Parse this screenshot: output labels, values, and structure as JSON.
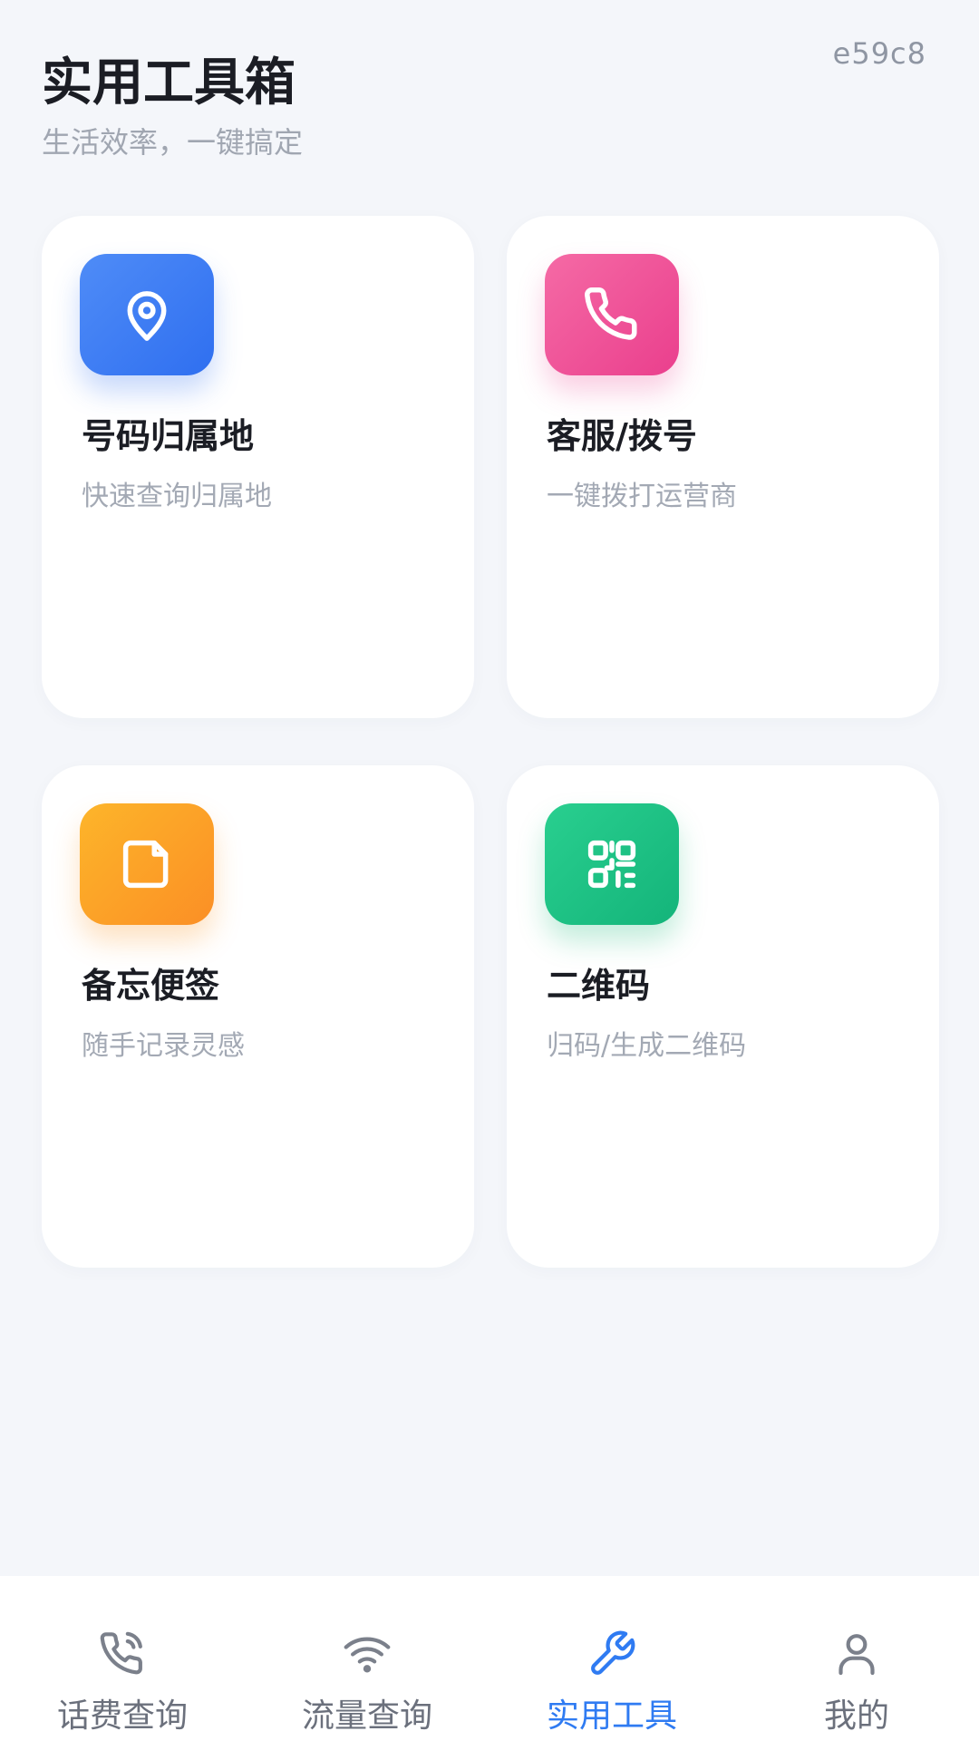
{
  "tag": "e59c8",
  "header": {
    "title": "实用工具箱",
    "subtitle": "生活效率，一键搞定"
  },
  "tools": [
    {
      "title": "号码归属地",
      "desc": "快速查询归属地",
      "icon": "location-pin-icon",
      "color": "#3f80f5"
    },
    {
      "title": "客服/拨号",
      "desc": "一键拨打运营商",
      "icon": "phone-icon",
      "color": "#ee5599"
    },
    {
      "title": "备忘便签",
      "desc": "随手记录灵感",
      "icon": "note-icon",
      "color": "#fca227"
    },
    {
      "title": "二维码",
      "desc": "归码/生成二维码",
      "icon": "qr-code-icon",
      "color": "#1fc285"
    }
  ],
  "tabs": [
    {
      "label": "话费查询",
      "icon": "phone-call-icon"
    },
    {
      "label": "流量查询",
      "icon": "wifi-icon"
    },
    {
      "label": "实用工具",
      "icon": "wrench-icon",
      "active": true
    },
    {
      "label": "我的",
      "icon": "user-icon"
    }
  ],
  "colors": {
    "background": "#f4f6fa",
    "active_tab": "#2f7bf2",
    "inactive_tab": "#6b707c"
  }
}
